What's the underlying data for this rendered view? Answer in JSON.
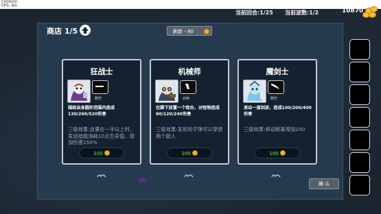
{
  "window": {
    "title": "coollion",
    "fps": "FPS: 60"
  },
  "hud": {
    "round": "当前回合:1/25",
    "wave": "当前波数:1/2",
    "coins": "10870"
  },
  "shop": {
    "title": "商店 1/5",
    "refresh_label": "刷新 - 80",
    "confirm_label": "确 认",
    "cards": [
      {
        "name": "狂战士",
        "tag": "群伤",
        "desc": "围绕自身圆形范围内造成130/260/520伤害",
        "level3": "三级效果:血量在一半以上时，发动技能消耗10点生命值，增加伤害150%",
        "price": "100"
      },
      {
        "name": "机械师",
        "tag": "召唤",
        "desc": "在脚下放置一个炮台，对怪物造成60/120/240伤害",
        "level3": "三级效果:发射的子弹可以穿透两个敌人",
        "price": "100"
      },
      {
        "name": "魔剑士",
        "tag": "群伤",
        "desc": "发出一道剑波，造成100/200/400伤害",
        "level3": "三级效果:移动距离增加200",
        "price": "100"
      }
    ]
  },
  "colors": {
    "background": "#1b2530",
    "panel": "#263a4e",
    "card_bg": "#142131",
    "price_text": "#7dec52",
    "coin": "#f2b81f"
  },
  "icons": [
    "up-arrow-icon",
    "coin-icon",
    "coin-pile-icon",
    "sword-icon",
    "dagger-icon",
    "curved-blade-icon"
  ]
}
